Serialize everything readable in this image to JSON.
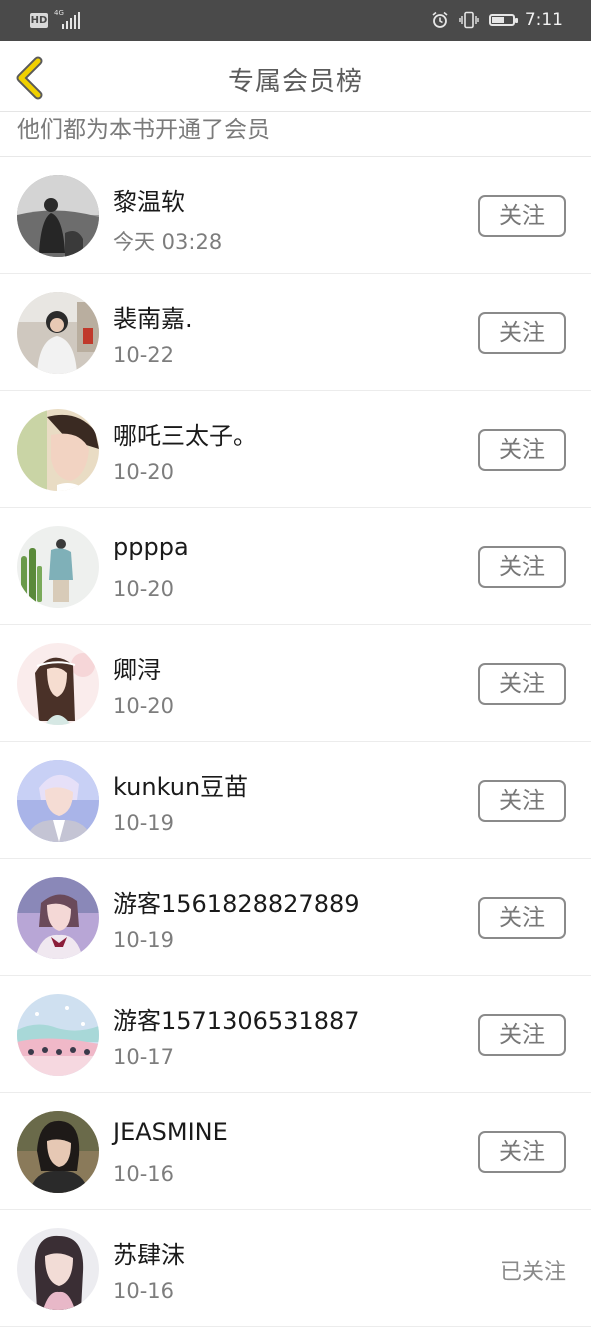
{
  "status_bar": {
    "hd": "HD",
    "network": "4G",
    "time": "7:11",
    "icons": [
      "alarm-icon",
      "vibrate-icon",
      "battery-icon"
    ]
  },
  "header": {
    "back_icon": "chevron-left-icon",
    "title": "专属会员榜",
    "accent_color": "#f0d000"
  },
  "subtitle": "他们都为本书开通了会员",
  "follow_label": "关注",
  "followed_label": "已关注",
  "members": [
    {
      "name": "黎温软",
      "time": "今天 03:28",
      "followed": false
    },
    {
      "name": "裴南嘉.",
      "time": "10-22",
      "followed": false
    },
    {
      "name": "哪吒三太子。",
      "time": "10-20",
      "followed": false
    },
    {
      "name": "ppppa",
      "time": "10-20",
      "followed": false
    },
    {
      "name": "卿浔",
      "time": "10-20",
      "followed": false
    },
    {
      "name": "kunkun豆苗",
      "time": "10-19",
      "followed": false
    },
    {
      "name": "游客1561828827889",
      "time": "10-19",
      "followed": false
    },
    {
      "name": "游客1571306531887",
      "time": "10-17",
      "followed": false
    },
    {
      "name": "JEASMINE",
      "time": "10-16",
      "followed": false
    },
    {
      "name": "苏肆沫",
      "time": "10-16",
      "followed": true
    }
  ]
}
